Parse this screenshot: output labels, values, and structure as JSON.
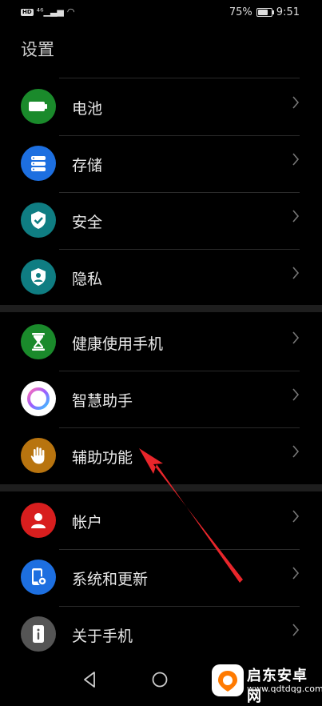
{
  "statusbar": {
    "battery_pct": "75%",
    "time": "9:51",
    "battery_level": 0.75
  },
  "page": {
    "title": "设置"
  },
  "items": [
    {
      "label": "电池",
      "icon": "battery-icon",
      "color": "#1a8a2b"
    },
    {
      "label": "存储",
      "icon": "storage-icon",
      "color": "#1d6fe0"
    },
    {
      "label": "安全",
      "icon": "shield-check-icon",
      "color": "#0f7d82"
    },
    {
      "label": "隐私",
      "icon": "privacy-icon",
      "color": "#0f7d82"
    },
    {
      "label": "健康使用手机",
      "icon": "hourglass-icon",
      "color": "#1a8a2b"
    },
    {
      "label": "智慧助手",
      "icon": "assistant-ring-icon",
      "color": "#ffffff"
    },
    {
      "label": "辅助功能",
      "icon": "hand-icon",
      "color": "#b8740f"
    },
    {
      "label": "帐户",
      "icon": "account-icon",
      "color": "#d81e1e"
    },
    {
      "label": "系统和更新",
      "icon": "system-update-icon",
      "color": "#1d6fe0"
    },
    {
      "label": "关于手机",
      "icon": "about-phone-icon",
      "color": "#555555"
    }
  ],
  "watermark": {
    "title": "启东安卓网",
    "url": "www.qdtdqg.com"
  }
}
